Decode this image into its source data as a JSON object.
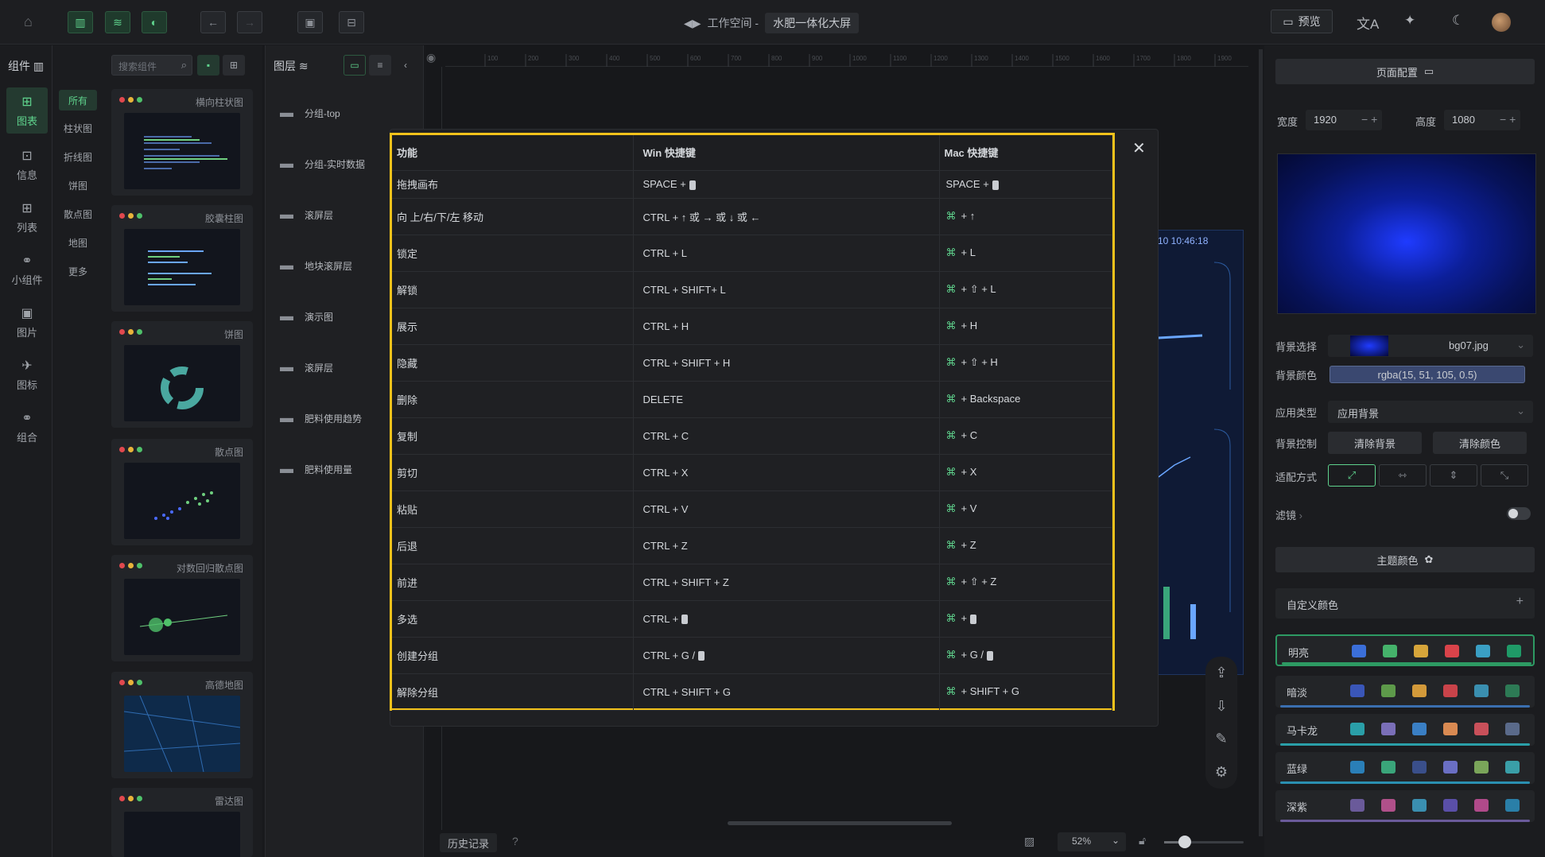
{
  "topbar": {
    "workspace_label": "工作空间 -",
    "project_name": "水肥一体化大屏",
    "preview_label": "预览"
  },
  "leftnav": {
    "header": "组件",
    "items": [
      {
        "label": "图表",
        "icon": "chart-icon"
      },
      {
        "label": "信息",
        "icon": "info-icon"
      },
      {
        "label": "列表",
        "icon": "table-icon"
      },
      {
        "label": "小组件",
        "icon": "widget-icon"
      },
      {
        "label": "图片",
        "icon": "image-icon"
      },
      {
        "label": "图标",
        "icon": "icon-icon"
      },
      {
        "label": "组合",
        "icon": "combo-icon"
      }
    ]
  },
  "categories": [
    "所有",
    "柱状图",
    "折线图",
    "饼图",
    "散点图",
    "地图",
    "更多"
  ],
  "components": {
    "search_placeholder": "搜索组件",
    "cards": [
      "横向柱状图",
      "胶囊柱图",
      "饼图",
      "散点图",
      "对数回归散点图",
      "高德地图",
      "雷达图"
    ]
  },
  "layers": {
    "header": "图层",
    "items": [
      "分组-top",
      "分组-实时数据",
      "滚屏层",
      "地块滚屏层",
      "演示图",
      "滚屏层",
      "肥料使用趋势",
      "肥料使用量"
    ]
  },
  "canvas": {
    "time_text": "10 10:46:18",
    "zoom": "52%",
    "history_label": "历史记录",
    "ruler_ticks": [
      "100",
      "200",
      "300",
      "400",
      "500",
      "600",
      "700",
      "800",
      "900",
      "1000",
      "1100",
      "1200",
      "1300",
      "1400",
      "1500",
      "1600",
      "1700",
      "1800",
      "1900"
    ]
  },
  "shortcuts": {
    "headers": [
      "功能",
      "Win 快捷键",
      "Mac 快捷键"
    ],
    "rows": [
      {
        "fn": "拖拽画布",
        "win": "SPACE +",
        "mac": "SPACE +",
        "win_key": true,
        "mac_key": true,
        "cmd": false
      },
      {
        "fn": "向 上/右/下/左 移动",
        "win": "CTRL + ↑ 或 → 或 ↓ 或 ←",
        "mac": "+ ↑",
        "cmd": true
      },
      {
        "fn": "锁定",
        "win": "CTRL + L",
        "mac": "+ L",
        "cmd": true
      },
      {
        "fn": "解锁",
        "win": "CTRL + SHIFT+ L",
        "mac": "+ ⇧ + L",
        "cmd": true
      },
      {
        "fn": "展示",
        "win": "CTRL + H",
        "mac": "+ H",
        "cmd": true
      },
      {
        "fn": "隐藏",
        "win": "CTRL + SHIFT + H",
        "mac": "+ ⇧ + H",
        "cmd": true
      },
      {
        "fn": "删除",
        "win": "DELETE",
        "mac": "+ Backspace",
        "cmd": true
      },
      {
        "fn": "复制",
        "win": "CTRL + C",
        "mac": "+ C",
        "cmd": true
      },
      {
        "fn": "剪切",
        "win": "CTRL + X",
        "mac": "+ X",
        "cmd": true
      },
      {
        "fn": "粘贴",
        "win": "CTRL + V",
        "mac": "+ V",
        "cmd": true
      },
      {
        "fn": "后退",
        "win": "CTRL + Z",
        "mac": "+ Z",
        "cmd": true
      },
      {
        "fn": "前进",
        "win": "CTRL + SHIFT + Z",
        "mac": "+ ⇧ + Z",
        "cmd": true
      },
      {
        "fn": "多选",
        "win": "CTRL +",
        "mac": "+",
        "win_key": true,
        "mac_key": true,
        "cmd": true
      },
      {
        "fn": "创建分组",
        "win": "CTRL + G /",
        "mac": "+ G /",
        "win_key": true,
        "mac_key": true,
        "cmd": true
      },
      {
        "fn": "解除分组",
        "win": "CTRL + SHIFT + G",
        "mac": "+ SHIFT + G",
        "cmd": true
      }
    ]
  },
  "rightpanel": {
    "page_config": "页面配置",
    "width_label": "宽度",
    "width_value": "1920",
    "height_label": "高度",
    "height_value": "1080",
    "bg_select_label": "背景选择",
    "bg_file": "bg07.jpg",
    "bg_color_label": "背景颜色",
    "bg_color_value": "rgba(15, 51, 105, 0.5)",
    "apply_type_label": "应用类型",
    "apply_type_value": "应用背景",
    "bg_control_label": "背景控制",
    "clear_bg": "清除背景",
    "clear_color": "清除颜色",
    "fit_label": "适配方式",
    "filter_label": "滤镜",
    "theme_header": "主题颜色",
    "custom_color": "自定义颜色",
    "themes": [
      {
        "name": "明亮",
        "colors": [
          "#3b6fd9",
          "#45b36b",
          "#d6a53a",
          "#d9434a",
          "#3a9fc4",
          "#1f9a67"
        ],
        "underline": "#2d9a63"
      },
      {
        "name": "暗淡",
        "colors": [
          "#3a56b8",
          "#5d9a4a",
          "#d39a3a",
          "#c9434a",
          "#3a8fb0",
          "#2d7a55"
        ],
        "underline": "#3a6fb0"
      },
      {
        "name": "马卡龙",
        "colors": [
          "#2a9fa8",
          "#7a6fb8",
          "#3a7fc4",
          "#d98a52",
          "#c9505a",
          "#5a6a8a"
        ],
        "underline": "#2a9fa8"
      },
      {
        "name": "蓝绿",
        "colors": [
          "#2a7fb8",
          "#3aa57a",
          "#3a4f8a",
          "#6a6fc4",
          "#7aa55a",
          "#3a9fa8"
        ],
        "underline": "#2a8fb0"
      },
      {
        "name": "深紫",
        "colors": [
          "#6a5a9a",
          "#b0508a",
          "#3a8fb0",
          "#5a4fa8",
          "#b04a8a",
          "#2a7fa8"
        ],
        "underline": "#6a5a9a"
      }
    ]
  }
}
